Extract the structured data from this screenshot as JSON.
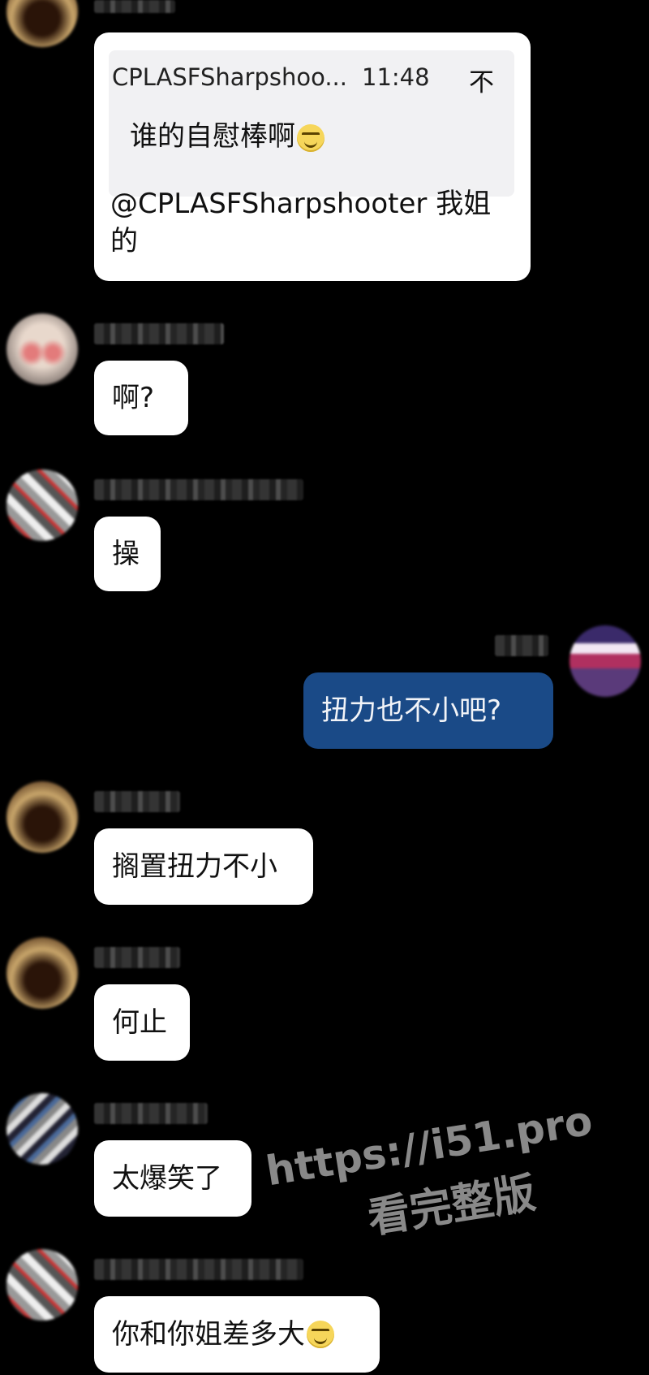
{
  "quote": {
    "sender": "CPLASFSharpshoo...",
    "time": "11:48",
    "pin": "不",
    "text": "谁的自慰棒啊",
    "reply": "@CPLASFSharpshooter 我姐的"
  },
  "messages": [
    {
      "text": "啊?"
    },
    {
      "text": "操"
    },
    {
      "text": "扭力也不小吧?"
    },
    {
      "text": "搁置扭力不小"
    },
    {
      "text": "何止"
    },
    {
      "text": "太爆笑了"
    },
    {
      "text": "你和你姐差多大"
    }
  ],
  "watermark": {
    "url": "https://i51.pro",
    "caption": "看完整版"
  },
  "colors": {
    "background": "#000000",
    "incoming_bubble": "#ffffff",
    "outgoing_bubble": "#1a4a87"
  }
}
